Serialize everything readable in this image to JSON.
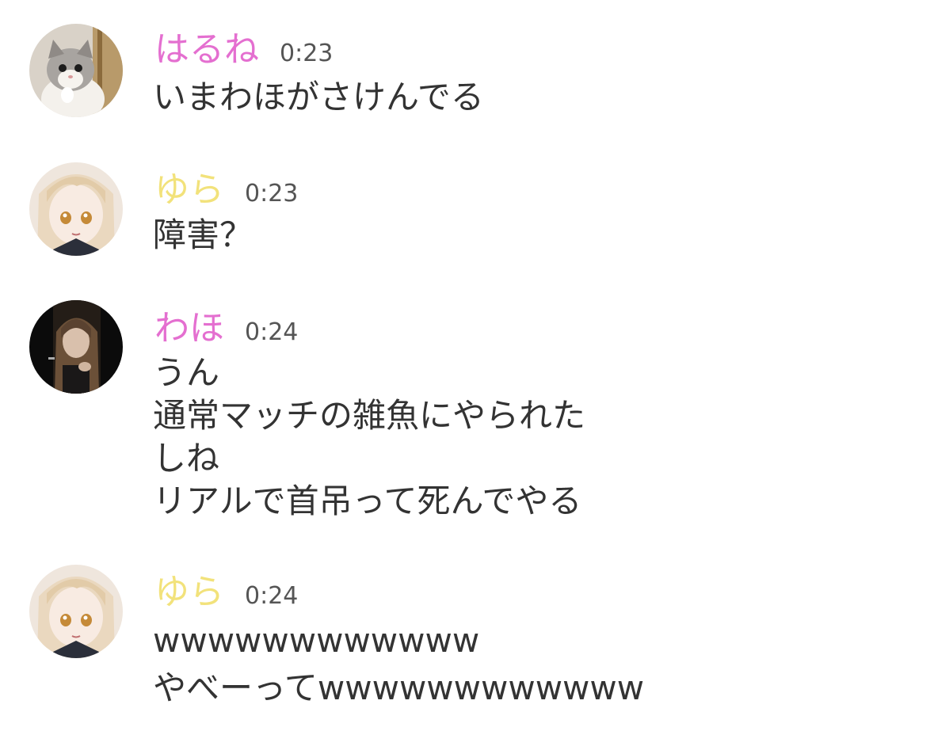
{
  "messages": [
    {
      "author": "はるね",
      "time": "0:23",
      "name_color": "#e46fd0",
      "avatar_icon": "kitten-avatar-icon",
      "lines": [
        "いまわほがさけんでる"
      ]
    },
    {
      "author": "ゆら",
      "time": "0:23",
      "name_color": "#f2e27b",
      "avatar_icon": "anime-girl-avatar-icon",
      "lines": [
        "障害？"
      ]
    },
    {
      "author": "わほ",
      "time": "0:24",
      "name_color": "#e46fd0",
      "avatar_icon": "dark-portrait-avatar-icon",
      "lines": [
        "うん",
        "通常マッチの雑魚にやられた",
        "しね",
        "リアルで首吊って死んでやる"
      ]
    },
    {
      "author": "ゆら",
      "time": "0:24",
      "name_color": "#f2e27b",
      "avatar_icon": "anime-girl-avatar-icon",
      "lines": [
        "wwwwwwwwwwww",
        "やべーってwwwwwwwwwwww"
      ]
    }
  ]
}
